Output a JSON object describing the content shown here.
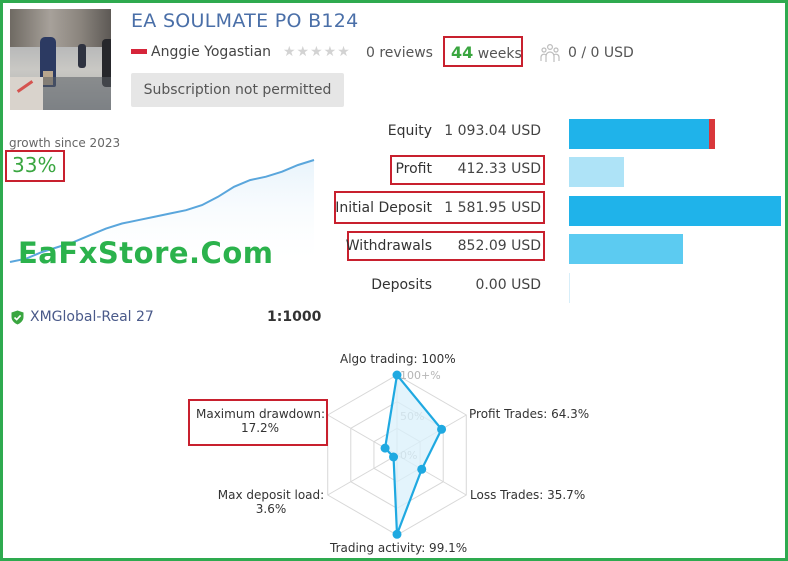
{
  "header": {
    "title": "EA SOULMATE PO B124",
    "author": "Anggie Yogastian",
    "rating_stars": 0,
    "reviews": "0 reviews",
    "weeks_number": "44",
    "weeks_unit": "weeks",
    "subscribers": "0 / 0 USD",
    "subscribe_button": "Subscription not permitted"
  },
  "icons": {
    "thumbnail": "signal-thumbnail-image",
    "flag": "country-flag-icon",
    "stars": "rating-stars-icon",
    "subscribers": "subscribers-icon",
    "broker": "verified-shield-check-icon"
  },
  "growth": {
    "label": "growth since 2023",
    "value": "33%",
    "series": [
      0,
      2,
      6,
      9,
      12,
      16,
      20,
      23,
      25,
      27,
      29,
      31,
      34,
      39,
      45,
      49,
      51,
      54,
      58,
      61
    ]
  },
  "watermark": "EaFxStore.Com",
  "broker": {
    "server": "XMGlobal-Real 27",
    "leverage": "1:1000"
  },
  "stats": [
    {
      "label": "Equity",
      "value": "1 093.04 USD",
      "amount": 1093.04,
      "highlighted": false,
      "color": "#1fb3ea",
      "accent": "#d9373b"
    },
    {
      "label": "Profit",
      "value": "412.33 USD",
      "amount": 412.33,
      "highlighted": true,
      "color": "#aee3f7"
    },
    {
      "label": "Initial Deposit",
      "value": "1 581.95 USD",
      "amount": 1581.95,
      "highlighted": true,
      "color": "#1fb3ea"
    },
    {
      "label": "Withdrawals",
      "value": "852.09 USD",
      "amount": 852.09,
      "highlighted": true,
      "color": "#5ccbf1"
    },
    {
      "label": "Deposits",
      "value": "0.00 USD",
      "amount": 0,
      "highlighted": false,
      "color": "#aee3f7"
    }
  ],
  "radar": {
    "axis_ticks": [
      "100+%",
      "50%",
      "0%"
    ],
    "axes": [
      {
        "name": "Algo trading",
        "label": "Algo trading: 100%",
        "value": 100
      },
      {
        "name": "Profit Trades",
        "label": "Profit Trades: 64.3%",
        "value": 64.3
      },
      {
        "name": "Loss Trades",
        "label": "Loss Trades: 35.7%",
        "value": 35.7
      },
      {
        "name": "Trading activity",
        "label": "Trading activity: 99.1%",
        "value": 99.1
      },
      {
        "name": "Max deposit load",
        "label_line1": "Max deposit load:",
        "label_line2": "3.6%",
        "value": 3.6
      },
      {
        "name": "Maximum drawdown",
        "label_line1": "Maximum drawdown:",
        "label_line2": "17.2%",
        "value": 17.2
      }
    ],
    "colors": {
      "line": "#1fa9e1",
      "fill": "#d9f0fb",
      "grid": "#d8d8d8"
    }
  },
  "colors": {
    "frame": "#2eaa4f",
    "highlight": "#c8202e",
    "title": "#4a6fa8",
    "green": "#3aa640"
  }
}
